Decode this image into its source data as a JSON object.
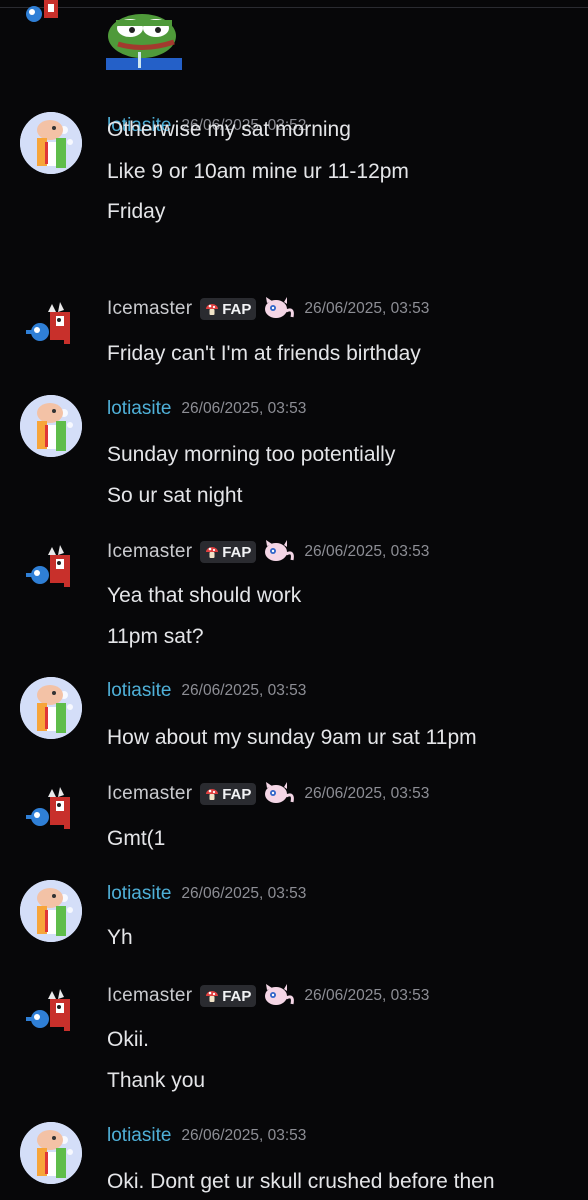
{
  "messages": [
    {
      "author": "lotiasite",
      "timestamp": "26/06/2025, 03:52",
      "lines": [
        "Otherwise my sat morning",
        "Like 9 or 10am mine ur 11-12pm",
        "Friday"
      ]
    },
    {
      "author_prefix": "I",
      "author_rest": "cemaster",
      "tag": "FAP",
      "timestamp": "26/06/2025, 03:53",
      "lines": [
        "Friday can't I'm at friends birthday"
      ]
    },
    {
      "author": "lotiasite",
      "timestamp": "26/06/2025, 03:53",
      "lines": [
        "Sunday morning too potentially",
        "So ur sat night"
      ]
    },
    {
      "author_prefix": "I",
      "author_rest": "cemaster",
      "tag": "FAP",
      "timestamp": "26/06/2025, 03:53",
      "lines": [
        "Yea that should work",
        "11pm sat?"
      ]
    },
    {
      "author": "lotiasite",
      "timestamp": "26/06/2025, 03:53",
      "lines": [
        "How about my sunday 9am ur sat 11pm"
      ]
    },
    {
      "author_prefix": "I",
      "author_rest": "cemaster",
      "tag": "FAP",
      "timestamp": "26/06/2025, 03:53",
      "lines": [
        "Gmt(1"
      ]
    },
    {
      "author": "lotiasite",
      "timestamp": "26/06/2025, 03:53",
      "lines": [
        "Yh"
      ]
    },
    {
      "author_prefix": "I",
      "author_rest": "cemaster",
      "tag": "FAP",
      "timestamp": "26/06/2025, 03:53",
      "lines": [
        "Okii.",
        "Thank you"
      ]
    },
    {
      "author": "lotiasite",
      "timestamp": "26/06/2025, 03:53",
      "lines": [
        "Oki. Dont get ur skull crushed before then"
      ]
    }
  ],
  "icons": {
    "emoji": "pepe-frog-icon",
    "lotia_avatar": "cartoon-avatar-icon",
    "ice_avatar": "pixel-creature-icon",
    "tag_icon": "mushroom-icon",
    "badge_icon": "mew-icon"
  },
  "colors": {
    "background": "#070709",
    "lotia_name": "#4fb0d8",
    "text": "#e4e5e8",
    "timestamp": "#8d8e95"
  }
}
